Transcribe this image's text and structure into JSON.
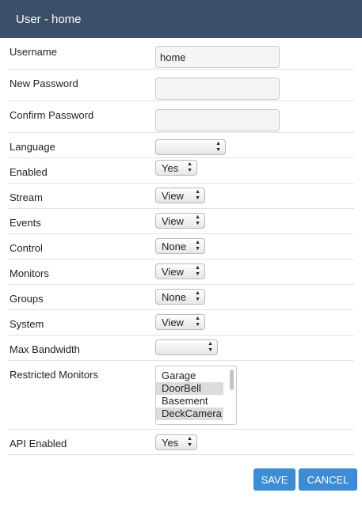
{
  "header": {
    "title": "User - home"
  },
  "fields": {
    "username": {
      "label": "Username",
      "value": "home"
    },
    "new_password": {
      "label": "New Password",
      "value": ""
    },
    "confirm_password": {
      "label": "Confirm Password",
      "value": ""
    },
    "language": {
      "label": "Language",
      "value": ""
    },
    "enabled": {
      "label": "Enabled",
      "value": "Yes"
    },
    "stream": {
      "label": "Stream",
      "value": "View"
    },
    "events": {
      "label": "Events",
      "value": "View"
    },
    "control": {
      "label": "Control",
      "value": "None"
    },
    "monitors": {
      "label": "Monitors",
      "value": "View"
    },
    "groups": {
      "label": "Groups",
      "value": "None"
    },
    "system": {
      "label": "System",
      "value": "View"
    },
    "max_bandwidth": {
      "label": "Max Bandwidth",
      "value": ""
    },
    "restricted_monitors": {
      "label": "Restricted Monitors",
      "options": [
        {
          "label": "Garage",
          "selected": false
        },
        {
          "label": "DoorBell",
          "selected": true
        },
        {
          "label": "Basement",
          "selected": false
        },
        {
          "label": "DeckCamera",
          "selected": true
        }
      ]
    },
    "api_enabled": {
      "label": "API Enabled",
      "value": "Yes"
    }
  },
  "buttons": {
    "save": "SAVE",
    "cancel": "CANCEL"
  },
  "icons": {
    "select_arrows": "updown-arrows-icon"
  },
  "colors": {
    "header_bg": "#3c4f6a",
    "button_bg": "#3d8dd6"
  }
}
